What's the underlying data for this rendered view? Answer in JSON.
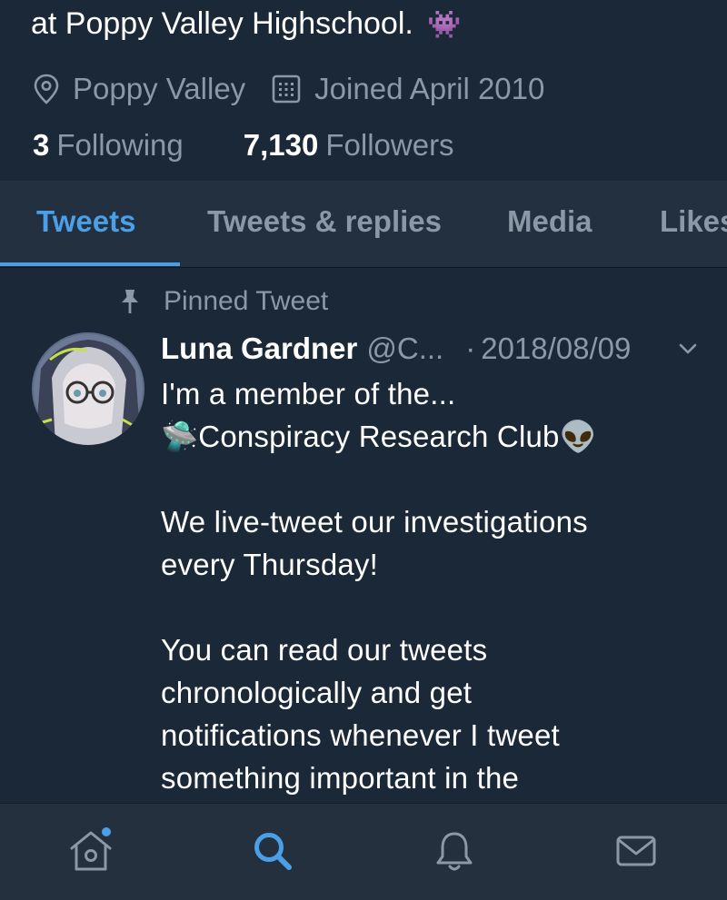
{
  "profile": {
    "bio_tail": "at Poppy Valley Highschool.",
    "bio_emoji": "👾",
    "location": "Poppy Valley",
    "joined": "Joined April 2010",
    "following_count": "3",
    "following_label": "Following",
    "followers_count": "7,130",
    "followers_label": "Followers"
  },
  "tabs": [
    {
      "label": "Tweets",
      "active": true
    },
    {
      "label": "Tweets & replies",
      "active": false
    },
    {
      "label": "Media",
      "active": false
    },
    {
      "label": "Likes",
      "active": false
    }
  ],
  "tweet": {
    "pinned_label": "Pinned Tweet",
    "author_name": "Luna Gardner",
    "handle": "@C...",
    "separator": "·",
    "date": "2018/08/09",
    "lines": [
      "I'm a member of the...",
      "🛸Conspiracy Research Club👽",
      "",
      "We live-tweet our investigations",
      "every Thursday!",
      "",
      "You can read our tweets",
      "chronologically and get",
      "notifications whenever I tweet",
      "something important in the"
    ]
  },
  "bottom_nav": [
    {
      "name": "home",
      "icon": "home-icon",
      "has_notification_dot": true
    },
    {
      "name": "search",
      "icon": "search-icon",
      "active": true
    },
    {
      "name": "notifications",
      "icon": "bell-icon"
    },
    {
      "name": "messages",
      "icon": "mail-icon"
    }
  ],
  "colors": {
    "background": "#1b2837",
    "tab_bar": "#22303f",
    "accent": "#4a9fe6",
    "secondary_text": "#8b98a5",
    "primary_text": "#ffffff"
  }
}
